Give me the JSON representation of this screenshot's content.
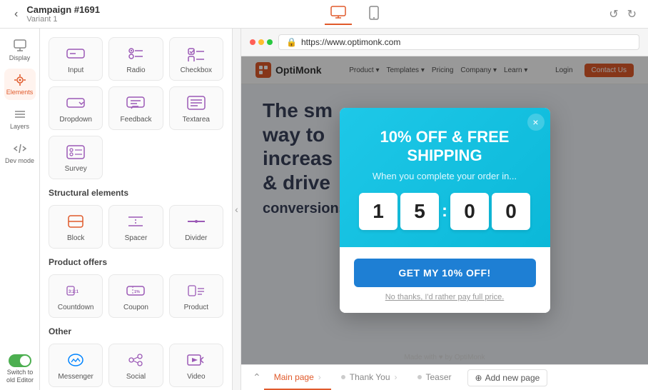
{
  "topBar": {
    "campaignTitle": "Campaign #1691",
    "campaignSubtitle": "Variant 1",
    "backLabel": "‹",
    "undoLabel": "↺",
    "redoLabel": "↻"
  },
  "deviceToggle": {
    "desktop": "desktop-icon",
    "mobile": "mobile-icon"
  },
  "iconNav": {
    "items": [
      {
        "id": "display",
        "label": "Display"
      },
      {
        "id": "elements",
        "label": "Elements",
        "active": true
      },
      {
        "id": "layers",
        "label": "Layers"
      },
      {
        "id": "devmode",
        "label": "Dev mode"
      }
    ]
  },
  "elementsPanel": {
    "sections": [
      {
        "title": "",
        "items": [
          {
            "id": "input",
            "label": "Input"
          },
          {
            "id": "radio",
            "label": "Radio"
          },
          {
            "id": "checkbox",
            "label": "Checkbox"
          },
          {
            "id": "dropdown",
            "label": "Dropdown"
          },
          {
            "id": "feedback",
            "label": "Feedback"
          },
          {
            "id": "textarea",
            "label": "Textarea"
          },
          {
            "id": "survey",
            "label": "Survey"
          }
        ]
      },
      {
        "title": "Structural elements",
        "items": [
          {
            "id": "block",
            "label": "Block"
          },
          {
            "id": "spacer",
            "label": "Spacer"
          },
          {
            "id": "divider",
            "label": "Divider"
          }
        ]
      },
      {
        "title": "Product offers",
        "items": [
          {
            "id": "countdown",
            "label": "Countdown"
          },
          {
            "id": "coupon",
            "label": "Coupon"
          },
          {
            "id": "product",
            "label": "Product"
          }
        ]
      },
      {
        "title": "Other",
        "items": [
          {
            "id": "messenger",
            "label": "Messenger"
          },
          {
            "id": "social",
            "label": "Social"
          },
          {
            "id": "video",
            "label": "Video"
          }
        ]
      }
    ]
  },
  "browser": {
    "url": "https://www.optimonk.com"
  },
  "siteHeader": {
    "logo": "OptiMonk",
    "navItems": [
      "Product ▾",
      "Templates ▾",
      "Pricing",
      "Company ▾",
      "Learn ▾"
    ],
    "loginLabel": "Login",
    "ctaLabel": "Contact Us"
  },
  "siteHero": {
    "line1": "The sm",
    "line2": "way to",
    "line3": "increas",
    "line4": "& drive",
    "line5": "conversions"
  },
  "modal": {
    "title": "10% OFF & FREE\nSHIPPING",
    "subtitle": "When you complete your order in...",
    "countdown": {
      "d1": "1",
      "d2": "5",
      "sep": ":",
      "m1": "0",
      "m2": "0"
    },
    "ctaLabel": "GET MY 10% OFF!",
    "declineLabel": "No thanks, I'd rather pay full price.",
    "closeLabel": "×"
  },
  "bottomTabs": {
    "tabs": [
      {
        "id": "main",
        "label": "Main page",
        "active": true
      },
      {
        "id": "thankyou",
        "label": "Thank You",
        "active": false
      },
      {
        "id": "teaser",
        "label": "Teaser",
        "active": false
      }
    ],
    "addPageLabel": "+ Add new page"
  },
  "oldEditor": {
    "label": "Switch to old Editor"
  }
}
